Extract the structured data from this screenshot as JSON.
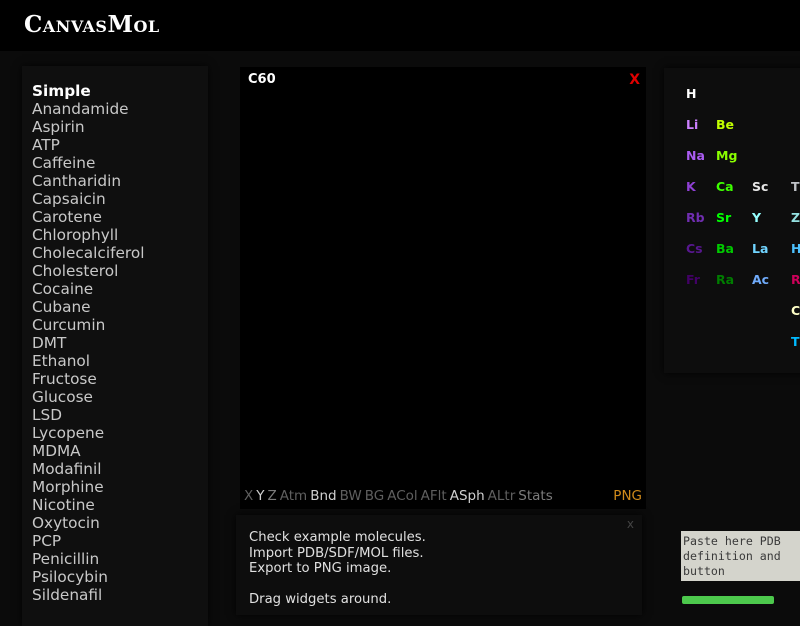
{
  "app": {
    "title": "CanvasMol"
  },
  "molecules": {
    "selected": "Simple",
    "items": [
      "Simple",
      "Anandamide",
      "Aspirin",
      "ATP",
      "Caffeine",
      "Cantharidin",
      "Capsaicin",
      "Carotene",
      "Chlorophyll",
      "Cholecalciferol",
      "Cholesterol",
      "Cocaine",
      "Cubane",
      "Curcumin",
      "DMT",
      "Ethanol",
      "Fructose",
      "Glucose",
      "LSD",
      "Lycopene",
      "MDMA",
      "Modafinil",
      "Morphine",
      "Nicotine",
      "Oxytocin",
      "PCP",
      "Penicillin",
      "Psilocybin",
      "Sildenafil"
    ]
  },
  "viewer": {
    "title": "C60",
    "close_label": "X",
    "toolbar": [
      {
        "key": "x",
        "label": "X",
        "style": "dim"
      },
      {
        "key": "y",
        "label": "Y",
        "style": "bright"
      },
      {
        "key": "z",
        "label": "Z",
        "style": "mid"
      },
      {
        "key": "atm",
        "label": "Atm",
        "style": "dim"
      },
      {
        "key": "bnd",
        "label": "Bnd",
        "style": "bright"
      },
      {
        "key": "bw",
        "label": "BW",
        "style": "dim"
      },
      {
        "key": "bg",
        "label": "BG",
        "style": "dim"
      },
      {
        "key": "acol",
        "label": "ACol",
        "style": "dim"
      },
      {
        "key": "aflt",
        "label": "AFlt",
        "style": "dim"
      },
      {
        "key": "asph",
        "label": "ASph",
        "style": "bright"
      },
      {
        "key": "altr",
        "label": "ALtr",
        "style": "dim"
      },
      {
        "key": "stats",
        "label": "Stats",
        "style": "mid"
      }
    ],
    "png_label": "PNG",
    "png_color": "#d08a1a"
  },
  "info": {
    "close_label": "x",
    "lines": [
      "Check example molecules.",
      "Import PDB/SDF/MOL files.",
      "Export to PNG image.",
      "",
      "Drag widgets around."
    ]
  },
  "periodic_table": {
    "elements": [
      {
        "symbol": "H",
        "color": "#ffffff",
        "row": 0,
        "col": 0
      },
      {
        "symbol": "Li",
        "color": "#cc80ff",
        "row": 1,
        "col": 0
      },
      {
        "symbol": "Be",
        "color": "#c2ff00",
        "row": 1,
        "col": 1
      },
      {
        "symbol": "Na",
        "color": "#ab5cf2",
        "row": 2,
        "col": 0
      },
      {
        "symbol": "Mg",
        "color": "#8aff00",
        "row": 2,
        "col": 1
      },
      {
        "symbol": "K",
        "color": "#8f40d4",
        "row": 3,
        "col": 0
      },
      {
        "symbol": "Ca",
        "color": "#3dff00",
        "row": 3,
        "col": 1
      },
      {
        "symbol": "Sc",
        "color": "#e6e6e6",
        "row": 3,
        "col": 2
      },
      {
        "symbol": "Ti",
        "color": "#bfc2c7",
        "row": 3,
        "col": 3
      },
      {
        "symbol": "Rb",
        "color": "#702eb0",
        "row": 4,
        "col": 0
      },
      {
        "symbol": "Sr",
        "color": "#00ff00",
        "row": 4,
        "col": 1
      },
      {
        "symbol": "Y",
        "color": "#94ffff",
        "row": 4,
        "col": 2
      },
      {
        "symbol": "Zr",
        "color": "#94e0e0",
        "row": 4,
        "col": 3
      },
      {
        "symbol": "Cs",
        "color": "#57178f",
        "row": 5,
        "col": 0
      },
      {
        "symbol": "Ba",
        "color": "#00c900",
        "row": 5,
        "col": 1
      },
      {
        "symbol": "La",
        "color": "#70d4ff",
        "row": 5,
        "col": 2
      },
      {
        "symbol": "Hf",
        "color": "#4dc2ff",
        "row": 5,
        "col": 3
      },
      {
        "symbol": "Fr",
        "color": "#420066",
        "row": 6,
        "col": 0
      },
      {
        "symbol": "Ra",
        "color": "#007d00",
        "row": 6,
        "col": 1
      },
      {
        "symbol": "Ac",
        "color": "#70abfa",
        "row": 6,
        "col": 2
      },
      {
        "symbol": "Rf",
        "color": "#cc0059",
        "row": 6,
        "col": 3
      },
      {
        "symbol": "Ce",
        "color": "#ffffc7",
        "row": 7,
        "col": 3
      },
      {
        "symbol": "Th",
        "color": "#00baff",
        "row": 8,
        "col": 3
      }
    ]
  },
  "paste": {
    "placeholder": "Paste here PDB definition and button"
  }
}
